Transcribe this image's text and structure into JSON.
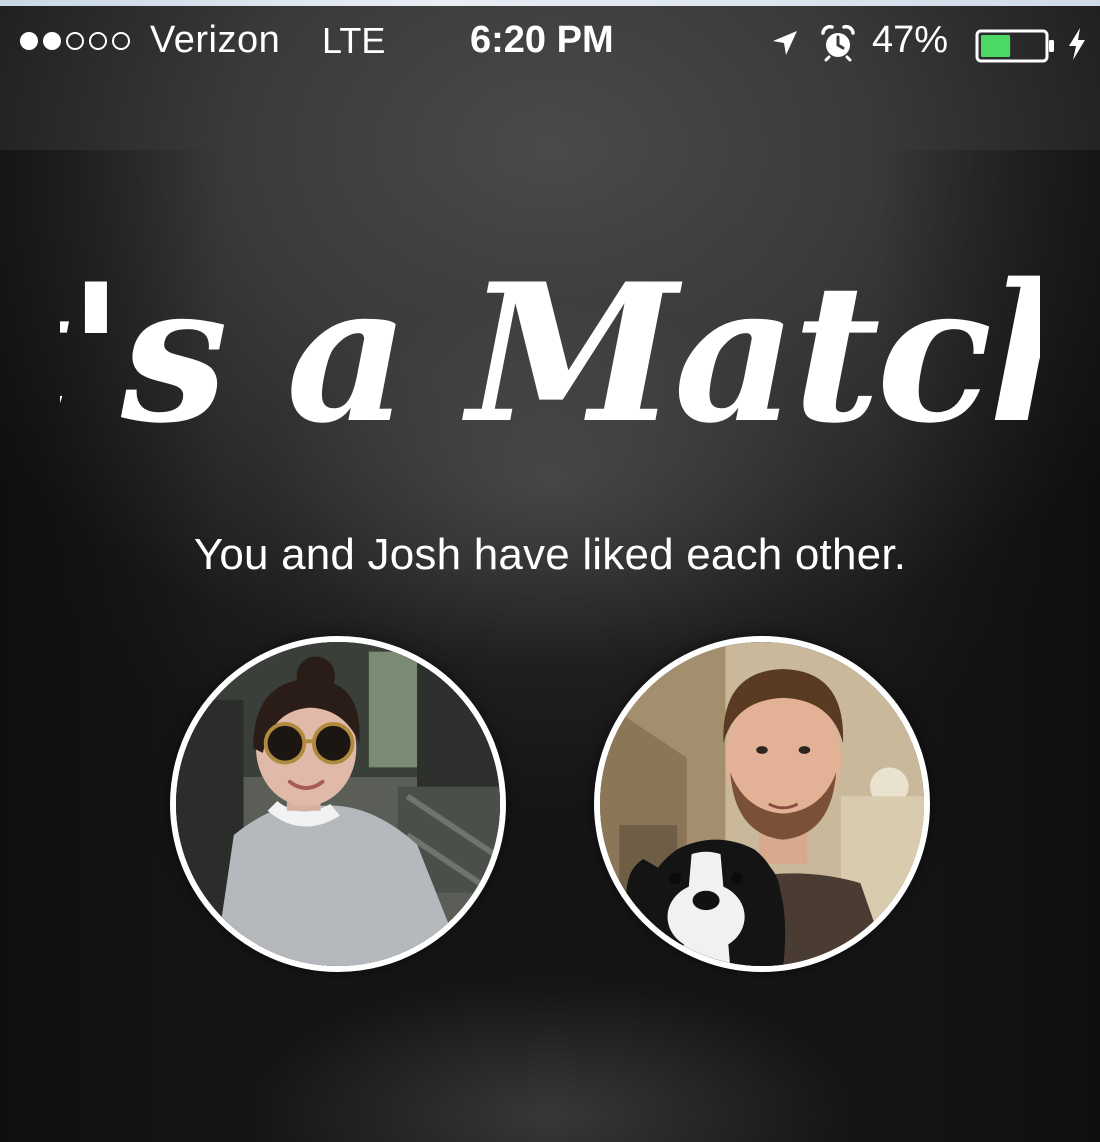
{
  "status_bar": {
    "signal_strength": 2,
    "signal_max": 5,
    "carrier": "Verizon",
    "network": "LTE",
    "time": "6:20 PM",
    "battery_percent": "47%",
    "battery_level": 0.47,
    "battery_color": "#4cd964",
    "icons": [
      "location-arrow-icon",
      "alarm-clock-icon",
      "battery-icon",
      "charging-bolt-icon"
    ]
  },
  "match": {
    "title": "It's a Match!",
    "message": "You and Josh have liked each other."
  },
  "avatars": {
    "user": {
      "alt": "User profile photo"
    },
    "match": {
      "alt": "Josh profile photo"
    }
  }
}
